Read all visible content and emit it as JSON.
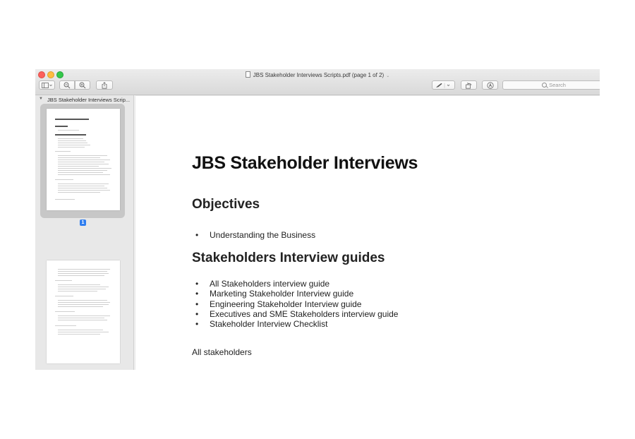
{
  "window": {
    "title": "JBS Stakeholder Interviews Scripts.pdf (page 1 of 2)",
    "title_chevron": "⌄"
  },
  "toolbar": {
    "sidebar_icon": "sidebar-toggle-icon",
    "zoom_out_icon": "zoom-out-icon",
    "zoom_in_icon": "zoom-in-icon",
    "share_icon": "share-icon",
    "markup_icon": "pen-icon",
    "rotate_icon": "rotate-icon",
    "annotate_icon": "markup-icon",
    "search_placeholder": "Search"
  },
  "sidebar": {
    "header_label": "JBS Stakeholder Interviews Scrip...",
    "selected_page_number": "1"
  },
  "document": {
    "title": "JBS Stakeholder Interviews",
    "objectives_heading": "Objectives",
    "objectives": [
      "Understanding the Business"
    ],
    "guides_heading": "Stakeholders Interview guides",
    "guides": [
      "All Stakeholders interview guide",
      "Marketing Stakeholder Interview guide",
      "Engineering Stakeholder Interview guide",
      "Executives and SME Stakeholders interview guide",
      "Stakeholder Interview Checklist"
    ],
    "section_text": "All stakeholders"
  },
  "colors": {
    "close": "#fc605c",
    "minimize": "#fdbc40",
    "maximize": "#34c84a",
    "selection_badge": "#2f7ef0"
  }
}
